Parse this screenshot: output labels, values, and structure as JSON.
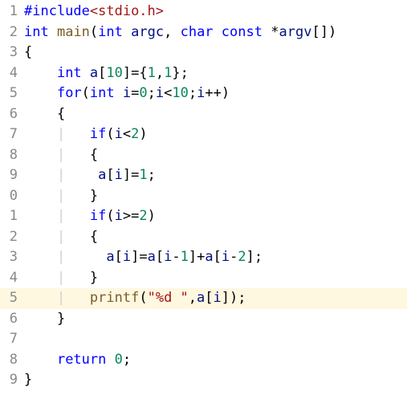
{
  "chart_data": {
    "type": "table",
    "title": "C source code listing",
    "language": "c",
    "lines": [
      {
        "n": 1,
        "text": "#include<stdio.h>"
      },
      {
        "n": 2,
        "text": "int main(int argc, char const *argv[])"
      },
      {
        "n": 3,
        "text": "{"
      },
      {
        "n": 4,
        "text": "    int a[10]={1,1};"
      },
      {
        "n": 5,
        "text": "    for(int i=0;i<10;i++)"
      },
      {
        "n": 6,
        "text": "    {"
      },
      {
        "n": 7,
        "text": "        if(i<2)"
      },
      {
        "n": 8,
        "text": "        {"
      },
      {
        "n": 9,
        "text": "         a[i]=1;"
      },
      {
        "n": 10,
        "text": "        }"
      },
      {
        "n": 11,
        "text": "        if(i>=2)"
      },
      {
        "n": 12,
        "text": "        {"
      },
      {
        "n": 13,
        "text": "          a[i]=a[i-1]+a[i-2];"
      },
      {
        "n": 14,
        "text": "        }"
      },
      {
        "n": 15,
        "text": "        printf(\"%d \",a[i]);",
        "highlight": true
      },
      {
        "n": 16,
        "text": "    }"
      },
      {
        "n": 17,
        "text": ""
      },
      {
        "n": 18,
        "text": "    return 0;"
      },
      {
        "n": 19,
        "text": "}"
      }
    ]
  },
  "gutter": {
    "l1": "1",
    "l2": "2",
    "l3": "3",
    "l4": "4",
    "l5": "5",
    "l6": "6",
    "l7": "7",
    "l8": "8",
    "l9": "9",
    "l10": "0",
    "l11": "1",
    "l12": "2",
    "l13": "3",
    "l14": "4",
    "l15": "5",
    "l16": "6",
    "l17": "7",
    "l18": "8",
    "l19": "9"
  },
  "tok": {
    "include": "#include",
    "stdio": "<stdio.h>",
    "int": "int",
    "main": "main",
    "argc": "argc",
    "char": "char",
    "const": "const",
    "argv": "argv",
    "obr": "[",
    "cbr": "]",
    "op": "(",
    "cp": ")",
    "ocb": "{",
    "ccb": "}",
    "a": "a",
    "ten": "10",
    "one": "1",
    "two": "2",
    "zero": "0",
    "for": "for",
    "i": "i",
    "if": "if",
    "printf": "printf",
    "fmt": "\"%d \"",
    "return": "return",
    "eq": "=",
    "semi": ";",
    "comma": ",",
    "star": "*",
    "lt": "<",
    "gte": ">=",
    "plus": "+",
    "pp": "++",
    "minus": "-",
    "sp4": "    ",
    "sp8": "        ",
    "sp9": "         ",
    "sp10": "          ",
    "guide": "|",
    "space": " "
  }
}
